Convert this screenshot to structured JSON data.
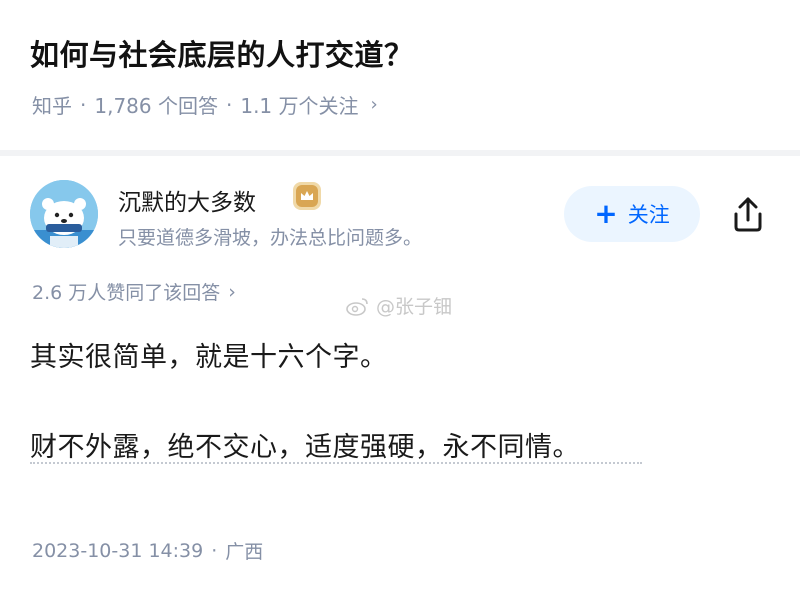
{
  "question": {
    "title": "如何与社会底层的人打交道？",
    "source": "知乎",
    "separator": "·",
    "answers_count": "1,786 个回答",
    "followers_count": "1.1 万个关注",
    "more_icon": "chevron-right-icon"
  },
  "author": {
    "name": "沉默的大多数",
    "bio": "只要道德多滑坡，办法总比问题多。",
    "avatar_icon": "avatar",
    "badge_icon": "crown-badge-icon",
    "follow_icon": "+",
    "follow_label": "关注",
    "share_icon": "share-icon"
  },
  "answer": {
    "upvotes": "2.6 万人赞同了该回答",
    "lines": [
      "其实很简单，就是十六个字。",
      "财不外露，绝不交心，适度强硬，永不同情。"
    ],
    "date": "2023-10-31 14:39",
    "location": "广西"
  },
  "watermark": {
    "text": "@张子钿",
    "icon": "weibo-icon"
  },
  "colors": {
    "accent": "#0066ff",
    "accent_bg": "#ebf5ff",
    "muted": "#8590a6",
    "badge": "#d9a653"
  }
}
